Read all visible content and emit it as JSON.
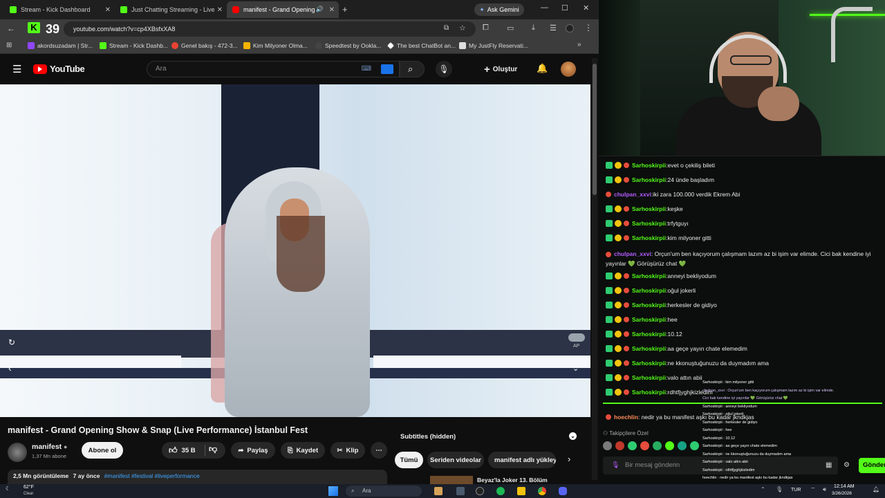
{
  "browser": {
    "tabs": [
      {
        "label": "Stream - Kick Dashboard"
      },
      {
        "label": "Just Chatting Streaming - Live"
      },
      {
        "label": "manifest - Grand Opening"
      }
    ],
    "new_tab": "+",
    "ask_gemini": "Ask Gemini",
    "viewer_count": "39",
    "url": "youtube.com/watch?v=cp4XBsfxXA8",
    "bookmarks": [
      {
        "label": "akordsuzadam | Str..."
      },
      {
        "label": "Stream - Kick Dashb..."
      },
      {
        "label": "Genel bakış - 472-3..."
      },
      {
        "label": "Kim Milyoner Olma..."
      },
      {
        "label": "Speedtest by Ookla..."
      },
      {
        "label": "The best ChatBot an..."
      },
      {
        "label": "My JustFly Reservati..."
      }
    ]
  },
  "youtube": {
    "logo_text": "YouTube",
    "search_placeholder": "Ara",
    "create_label": "Oluştur",
    "video_title": "manifest - Grand Opening Show & Snap (Live Performance) İstanbul Fest",
    "channel_name": "manifest",
    "subscribers": "1,37 Mn abone",
    "subscribe_label": "Abone ol",
    "likes": "35 B",
    "share_label": "Paylaş",
    "save_label": "Kaydet",
    "clip_label": "Klip",
    "views": "2,5 Mn görüntüleme",
    "age": "7 ay önce",
    "hashtags": "#manifest #festival #liveperformance",
    "subtitles": "Subtitles (hidden)",
    "filters": [
      "Tümü",
      "Seriden videolar",
      "manifest adlı yükleyi"
    ],
    "next_video": "Beyaz'la Joker 13. Bölüm",
    "video_badge": "AP"
  },
  "chat": {
    "messages": [
      {
        "user": "Sarhoskirpii",
        "text": "evet o çekiliş bileti",
        "color": "green"
      },
      {
        "user": "Sarhoskirpii",
        "text": "24 ünde başladım",
        "color": "green"
      },
      {
        "user": "chulpan_xxvi",
        "text": "iki zara 100.000 verdik Ekrem Abi",
        "color": "purple"
      },
      {
        "user": "Sarhoskirpii",
        "text": "keşke",
        "color": "green"
      },
      {
        "user": "Sarhoskirpii",
        "text": "trfytguyı",
        "color": "green"
      },
      {
        "user": "Sarhoskirpii",
        "text": "kim milyoner gitti",
        "color": "green"
      },
      {
        "user": "chulpan_xxvi",
        "text": "Orçun'um ben kaçıyorum çalışmam lazım az bi işim var elimde. Cici bak kendine iyi yayınlar 💚 Görüşürüz chat 💚",
        "color": "purple"
      },
      {
        "user": "Sarhoskirpii",
        "text": "anneyi bekliyodum",
        "color": "green"
      },
      {
        "user": "Sarhoskirpii",
        "text": "oğul jokerli",
        "color": "green"
      },
      {
        "user": "Sarhoskirpii",
        "text": "herkesler de gidiyo",
        "color": "green"
      },
      {
        "user": "Sarhoskirpii",
        "text": "hee",
        "color": "green"
      },
      {
        "user": "Sarhoskirpii",
        "text": "10.12",
        "color": "green"
      },
      {
        "user": "Sarhoskirpii",
        "text": "aa geçe yayın chate elemedim",
        "color": "green"
      },
      {
        "user": "Sarhoskirpii",
        "text": "ne kkonuştuğunuzu da duymadım ama",
        "color": "green"
      },
      {
        "user": "Sarhoskirpii",
        "text": "valo attın abii",
        "color": "green"
      },
      {
        "user": "Sarhoskirpii",
        "text": "rdhtfjyghjkizledim",
        "color": "green"
      }
    ],
    "pinned_user": "hoechlin",
    "pinned_text": "nedir ya bu manifest aşkı bu kadar jkndkjas",
    "followers_label": "Takipçilere Özel",
    "input_placeholder": "Bir mesaj gönderin",
    "send_label": "Gönder",
    "mini_overlay": [
      "Sarhoskirpii : kim milyoner gitti",
      "chulpan_xxvi : Orçun'um ben kaçıyorum çalışmam lazım az bi işim var elimde.",
      "Cici bak kendine iyi yayınlar 💚 Görüşürüz chat 💚",
      "Sarhoskirpii : anneyi bekliyodum",
      "Sarhoskirpii : oğul jokerli",
      "Sarhoskirpii : herkesler de gidiyo",
      "Sarhoskirpii : hee",
      "Sarhoskirpii : 10.12",
      "Sarhoskirpii : aa geçe yayın chate elemedim",
      "Sarhoskirpii : ne kkonuştuğunuzu da duymadım ama",
      "Sarhoskirpii : valo attın abii",
      "Sarhoskirpii : rdhtfjyghjkizledim",
      "hoechlin : nedir ya bu manifest aşkı bu kadar jkndkjas"
    ]
  },
  "taskbar": {
    "weather_temp": "62°F",
    "weather_desc": "Clear",
    "search_label": "Ara",
    "lang": "TUR",
    "time": "12:14 AM",
    "date": "3/26/2026"
  }
}
